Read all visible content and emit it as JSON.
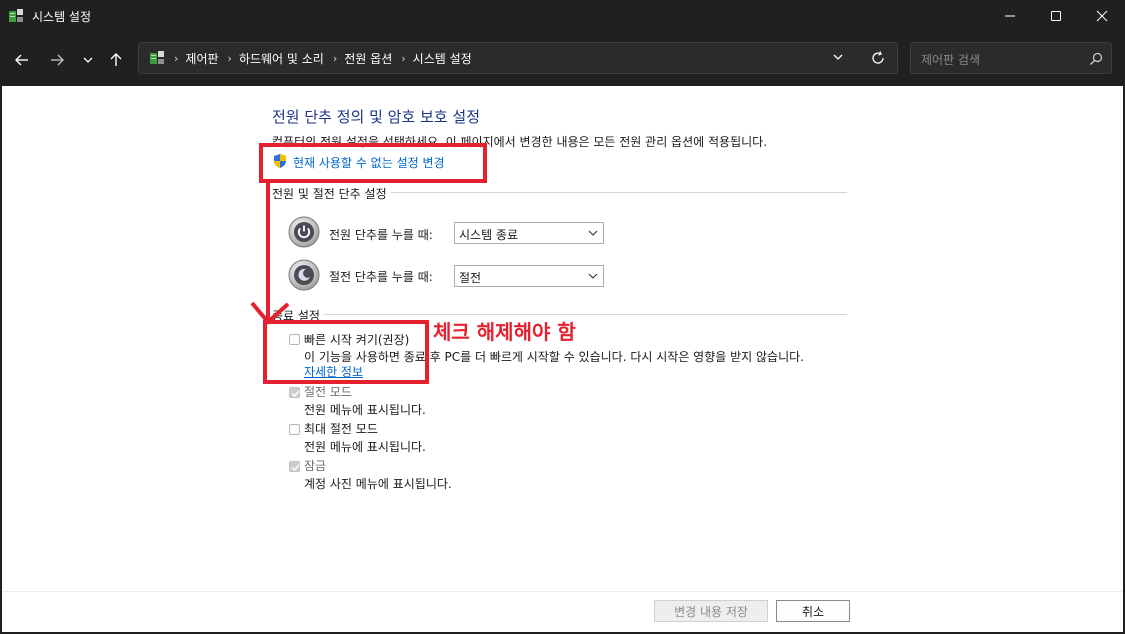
{
  "window": {
    "title": "시스템 설정"
  },
  "address": {
    "crumbs": [
      "제어판",
      "하드웨어 및 소리",
      "전원 옵션",
      "시스템 설정"
    ]
  },
  "search": {
    "placeholder": "제어판 검색"
  },
  "page": {
    "heading": "전원 단추 정의 및 암호 보호 설정",
    "description": "컴퓨터의 전원 설정을 선택하세요. 이 페이지에서 변경한 내용은 모든 전원 관리 옵션에 적용됩니다.",
    "admin_link": "현재 사용할 수 없는 설정 변경"
  },
  "power_group": {
    "title": "전원 및 절전 단추 설정",
    "power_button_label": "전원 단추를 누를 때:",
    "power_button_value": "시스템 종료",
    "sleep_button_label": "절전 단추를 누를 때:",
    "sleep_button_value": "절전"
  },
  "shutdown_group": {
    "title": "종료 설정",
    "items": [
      {
        "label": "빠른 시작 켜기(권장)",
        "detail": "이 기능을 사용하면 종료 후 PC를 더 빠르게 시작할 수 있습니다. 다시 시작은 영향을 받지 않습니다.",
        "link": "자세한 정보",
        "checked": false
      },
      {
        "label": "절전 모드",
        "detail": "전원 메뉴에 표시됩니다.",
        "checked": true
      },
      {
        "label": "최대 절전 모드",
        "detail": "전원 메뉴에 표시됩니다.",
        "checked": false
      },
      {
        "label": "잠금",
        "detail": "계정 사진 메뉴에 표시됩니다.",
        "checked": true
      }
    ]
  },
  "buttons": {
    "save": "변경 내용 저장",
    "cancel": "취소"
  },
  "annotation": {
    "text": "체크 해제해야 함",
    "color": "#e5202f"
  },
  "colors": {
    "heading": "#1e3287",
    "link": "#0066cc",
    "titlebar": "#202020"
  }
}
